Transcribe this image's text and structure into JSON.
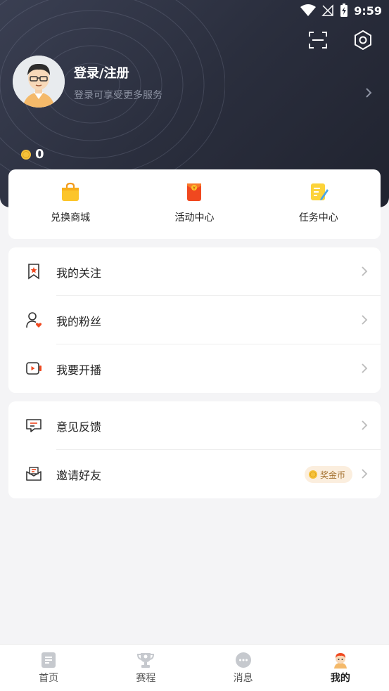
{
  "status_bar": {
    "time": "9:59"
  },
  "profile": {
    "login_title": "登录/注册",
    "login_subtitle": "登录可享受更多服务",
    "coin_count": "0"
  },
  "quick_actions": [
    {
      "label": "兑换商城",
      "icon": "shopping-bag-icon"
    },
    {
      "label": "活动中心",
      "icon": "red-envelope-icon"
    },
    {
      "label": "任务中心",
      "icon": "task-note-icon"
    }
  ],
  "menu_group_1": [
    {
      "label": "我的关注",
      "icon": "bookmark-star-icon"
    },
    {
      "label": "我的粉丝",
      "icon": "user-heart-icon"
    },
    {
      "label": "我要开播",
      "icon": "live-video-icon"
    }
  ],
  "menu_group_2": [
    {
      "label": "意见反馈",
      "icon": "feedback-icon"
    },
    {
      "label": "邀请好友",
      "icon": "mail-invite-icon",
      "badge": "奖金币"
    }
  ],
  "bottom_nav": [
    {
      "label": "首页",
      "icon": "home-doc-icon",
      "active": false
    },
    {
      "label": "赛程",
      "icon": "trophy-icon",
      "active": false
    },
    {
      "label": "消息",
      "icon": "message-bubble-icon",
      "active": false
    },
    {
      "label": "我的",
      "icon": "profile-avatar-icon",
      "active": true
    }
  ],
  "colors": {
    "header_dark": "#2a2e3d",
    "accent_orange": "#f5a623",
    "page_bg": "#f4f4f6",
    "badge_bg": "#fbeede"
  }
}
